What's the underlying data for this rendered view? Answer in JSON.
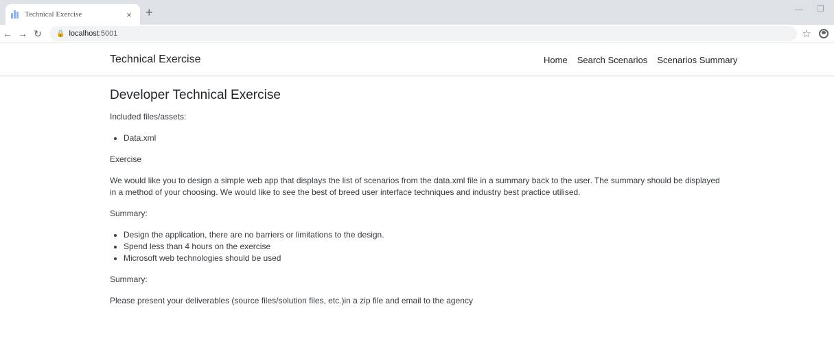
{
  "browser": {
    "tab_title": "Technical Exercise",
    "tab_close": "×",
    "new_tab": "+",
    "url_host": "localhost",
    "url_port": ":5001",
    "icons": [
      "back-arrow-icon",
      "forward-arrow-icon",
      "reload-icon",
      "lock-icon",
      "star-icon",
      "profile-icon"
    ]
  },
  "navbar": {
    "brand": "Technical Exercise",
    "links": [
      "Home",
      "Search Scenarios",
      "Scenarios Summary"
    ]
  },
  "content": {
    "heading": "Developer Technical Exercise",
    "included_label": "Included files/assets:",
    "files": [
      "Data.xml"
    ],
    "exercise_label": "Exercise",
    "description": "We would like you to design a simple web app that displays the list of scenarios from the data.xml file in a summary back to the user. The summary should be displayed in a method of your choosing. We would like to see the best of breed user interface techniques and industry best practice utilised.",
    "summary_label_1": "Summary:",
    "summary_items": [
      "Design the application, there are no barriers or limitations to the design.",
      "Spend less than 4 hours on the exercise",
      "Microsoft web technologies should be used"
    ],
    "summary_label_2": "Summary:",
    "deliverables": "Please present your deliverables (source files/solution files, etc.)in a zip file and email to the agency"
  }
}
